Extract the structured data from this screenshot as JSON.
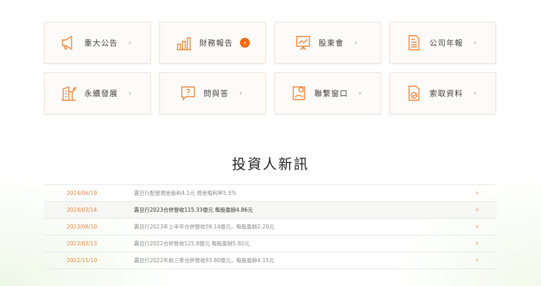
{
  "cards": [
    {
      "label": "重大公告",
      "icon": "megaphone-icon"
    },
    {
      "label": "財務報告",
      "icon": "bar-chart-icon",
      "active": true
    },
    {
      "label": "股東會",
      "icon": "presentation-board-icon"
    },
    {
      "label": "公司年報",
      "icon": "document-icon"
    },
    {
      "label": "永續發展",
      "icon": "building-plant-icon"
    },
    {
      "label": "問與答",
      "icon": "question-bubble-icon"
    },
    {
      "label": "聯繫窗口",
      "icon": "contact-person-icon"
    },
    {
      "label": "索取資料",
      "icon": "file-check-icon"
    }
  ],
  "news_title": "投資人新訊",
  "news": [
    {
      "date": "2024/06/19",
      "title": "震旦行配發現金股利4.1元 現金殖利率5.5%"
    },
    {
      "date": "2024/03/14",
      "title": "震旦行2023合併營收115.33億元 每股盈餘4.86元"
    },
    {
      "date": "2023/08/10",
      "title": "震旦行2023年上半年合併營收59.14億元，每股盈餘2.20元"
    },
    {
      "date": "2023/03/13",
      "title": "震旦行2022合併營收125.8億元 每股盈餘5.82元"
    },
    {
      "date": "2022/11/10",
      "title": "震旦行2022年前三季合併營收93.80億元，每股盈餘4.15元"
    }
  ],
  "chevron": "›",
  "accent": "#f26a12"
}
